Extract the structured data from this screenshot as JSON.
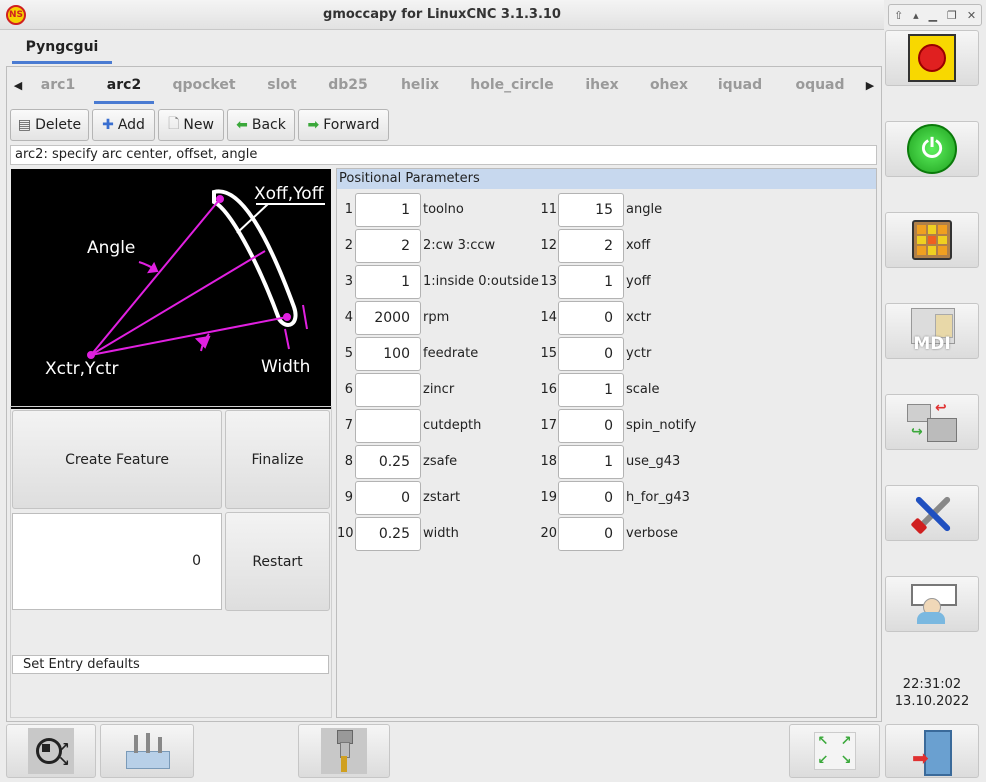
{
  "window": {
    "title": "gmoccapy for LinuxCNC  3.1.3.10"
  },
  "notebook": {
    "main_tab": "Pyngcgui"
  },
  "subtabs": [
    "arc1",
    "arc2",
    "qpocket",
    "slot",
    "db25",
    "helix",
    "hole_circle",
    "ihex",
    "ohex",
    "iquad",
    "oquad"
  ],
  "active_subtab": "arc2",
  "toolbar": {
    "delete": "Delete",
    "add": "Add",
    "new": "New",
    "back": "Back",
    "forward": "Forward"
  },
  "description": "arc2: specify arc center, offset, angle",
  "diagram": {
    "labels": {
      "xoff_yoff": "Xoff,Yoff",
      "angle": "Angle",
      "xctr_yctr": "Xctr,Yctr",
      "width": "Width"
    }
  },
  "buttons": {
    "create_feature": "Create Feature",
    "finalize": "Finalize",
    "restart": "Restart"
  },
  "readout": {
    "value": "0"
  },
  "status_line": "Set Entry defaults",
  "params": {
    "header": "Positional Parameters",
    "rows": [
      {
        "num": "1",
        "value": "1",
        "label": "toolno"
      },
      {
        "num": "2",
        "value": "2",
        "label": "2:cw 3:ccw"
      },
      {
        "num": "3",
        "value": "1",
        "label": "1:inside 0:outside"
      },
      {
        "num": "4",
        "value": "2000",
        "label": "rpm"
      },
      {
        "num": "5",
        "value": "100",
        "label": "feedrate"
      },
      {
        "num": "6",
        "value": "",
        "label": "zincr"
      },
      {
        "num": "7",
        "value": "",
        "label": "cutdepth"
      },
      {
        "num": "8",
        "value": "0.25",
        "label": "zsafe"
      },
      {
        "num": "9",
        "value": "0",
        "label": "zstart"
      },
      {
        "num": "10",
        "value": "0.25",
        "label": "width"
      },
      {
        "num": "11",
        "value": "15",
        "label": "angle"
      },
      {
        "num": "12",
        "value": "2",
        "label": "xoff"
      },
      {
        "num": "13",
        "value": "1",
        "label": "yoff"
      },
      {
        "num": "14",
        "value": "0",
        "label": "xctr"
      },
      {
        "num": "15",
        "value": "0",
        "label": "yctr"
      },
      {
        "num": "16",
        "value": "1",
        "label": "scale"
      },
      {
        "num": "17",
        "value": "0",
        "label": "spin_notify"
      },
      {
        "num": "18",
        "value": "1",
        "label": "use_g43"
      },
      {
        "num": "19",
        "value": "0",
        "label": "h_for_g43"
      },
      {
        "num": "20",
        "value": "0",
        "label": "verbose"
      }
    ]
  },
  "sidebar": {
    "mdi_label": "MDI"
  },
  "clock": {
    "time": "22:31:02",
    "date": "13.10.2022"
  },
  "colors": {
    "accent": "#4a7bd2",
    "power_green": "#2ec02e",
    "estop_red": "#e02020",
    "diagram_magenta": "#e020e0"
  }
}
